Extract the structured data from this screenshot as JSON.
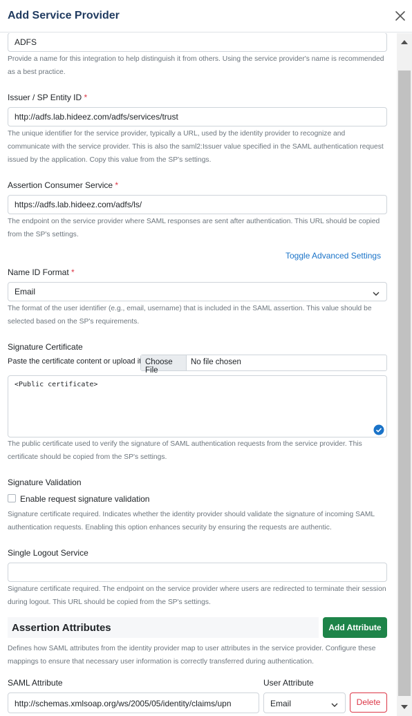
{
  "dialog": {
    "title": "Add Service Provider"
  },
  "name_field": {
    "value": "ADFS",
    "help": "Provide a name for this integration to help distinguish it from others. Using the service provider's name is recommended as a best practice."
  },
  "issuer_field": {
    "label": "Issuer / SP Entity ID",
    "required_mark": "*",
    "value": "http://adfs.lab.hideez.com/adfs/services/trust",
    "help": "The unique identifier for the service provider, typically a URL, used by the identity provider to recognize and communicate with the service provider. This is also the saml2:Issuer value specified in the SAML authentication request issued by the application. Copy this value from the SP's settings."
  },
  "acs_field": {
    "label": "Assertion Consumer Service",
    "required_mark": "*",
    "value": "https://adfs.lab.hideez.com/adfs/ls/",
    "help": "The endpoint on the service provider where SAML responses are sent after authentication. This URL should be copied from the SP's settings."
  },
  "toggle_advanced": "Toggle Advanced Settings",
  "nameid_field": {
    "label": "Name ID Format",
    "required_mark": "*",
    "selected": "Email",
    "help": "The format of the user identifier (e.g., email, username) that is included in the SAML assertion. This value should be selected based on the SP's requirements."
  },
  "signature_certificate": {
    "label": "Signature Certificate",
    "paste_label": "Paste the certificate content or upload it",
    "choose_file": "Choose File",
    "file_status": "No file chosen",
    "placeholder": "<Public certificate>",
    "help": "The public certificate used to verify the signature of SAML authentication requests from the service provider. This certificate should be copied from the SP's settings."
  },
  "signature_validation": {
    "label": "Signature Validation",
    "checkbox_label": "Enable request signature validation",
    "checked": false,
    "help": "Signature certificate required. Indicates whether the identity provider should validate the signature of incoming SAML authentication requests. Enabling this option enhances security by ensuring the requests are authentic."
  },
  "single_logout": {
    "label": "Single Logout Service",
    "value": "",
    "help": "Signature certificate required. The endpoint on the service provider where users are redirected to terminate their session during logout. This URL should be copied from the SP's settings."
  },
  "assertion_attributes": {
    "title": "Assertion Attributes",
    "add_button": "Add Attribute",
    "help": "Defines how SAML attributes from the identity provider map to user attributes in the service provider. Configure these mappings to ensure that necessary user information is correctly transferred during authentication.",
    "saml_attribute_label": "SAML Attribute",
    "user_attribute_label": "User Attribute",
    "rows": [
      {
        "saml_attribute": "http://schemas.xmlsoap.org/ws/2005/05/identity/claims/upn",
        "user_attribute": "Email",
        "delete_label": "Delete"
      }
    ]
  },
  "colors": {
    "accent": "#1a73c8",
    "primary_green": "#1e8449",
    "danger": "#dc3545",
    "title": "#1f3a5f"
  }
}
